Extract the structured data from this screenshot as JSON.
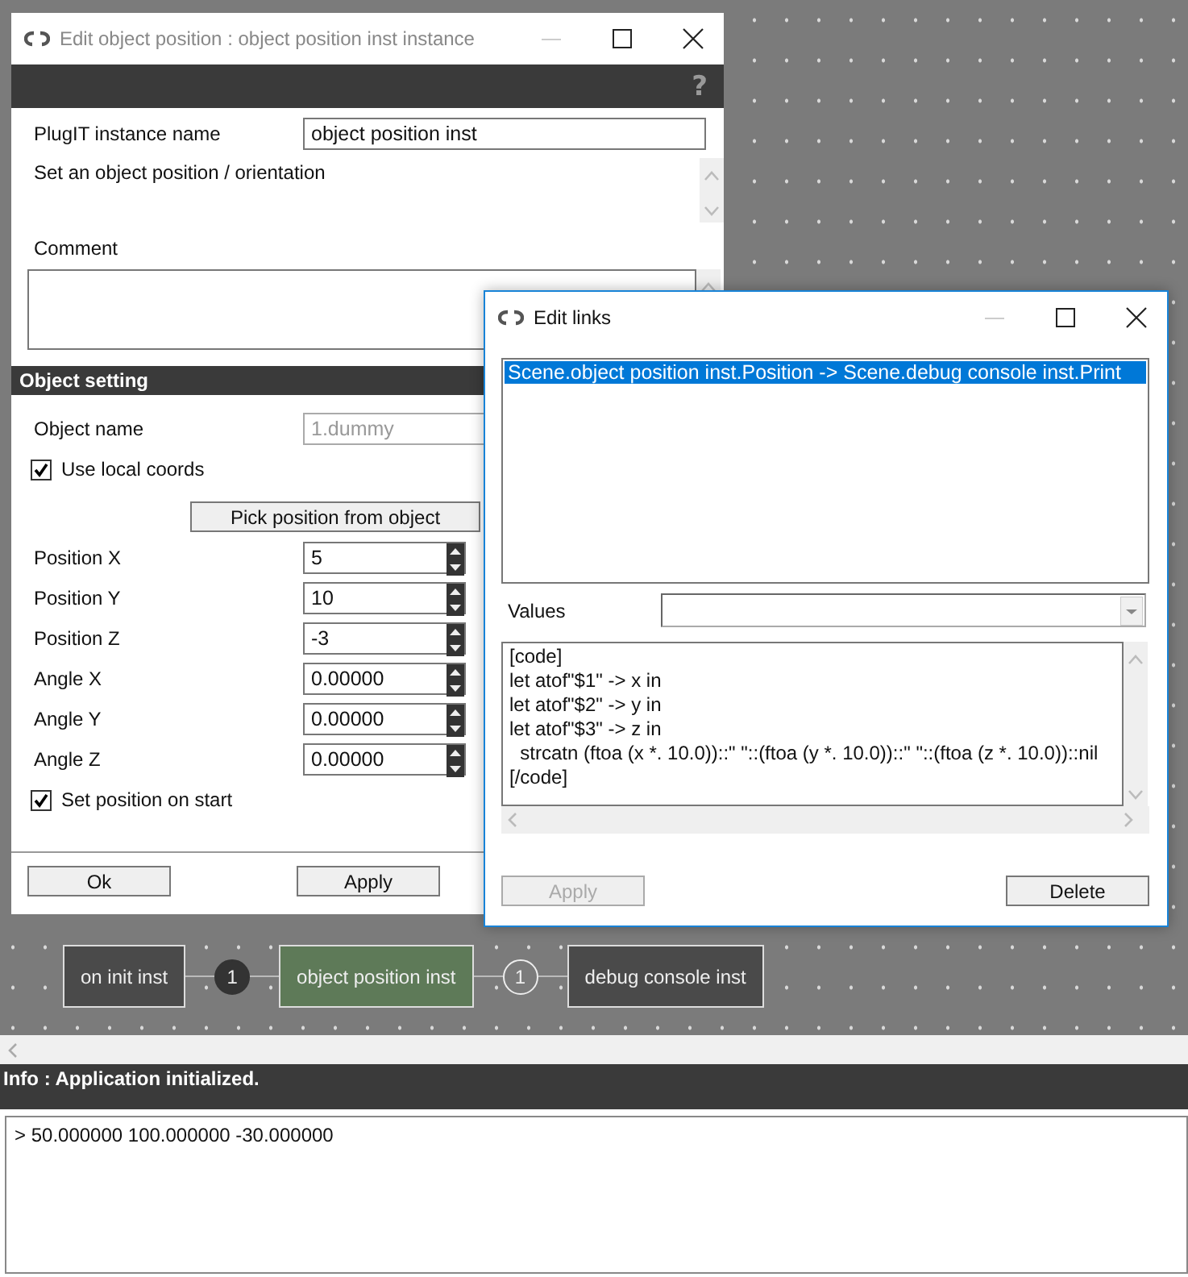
{
  "object_window": {
    "title": "Edit object position : object position inst instance",
    "help": "?",
    "instance_name": {
      "label": "PlugIT instance name",
      "value": "object position inst"
    },
    "description": "Set an object position / orientation",
    "comment": {
      "label": "Comment"
    },
    "section": "Object setting",
    "object_name": {
      "label": "Object name",
      "value": "1.dummy",
      "disabled": true
    },
    "use_local_coords": {
      "label": "Use local coords",
      "checked": true
    },
    "pick_button": "Pick position from object",
    "spinners": [
      {
        "label": "Position X",
        "value": "5"
      },
      {
        "label": "Position Y",
        "value": "10"
      },
      {
        "label": "Position Z",
        "value": "-3"
      },
      {
        "label": "Angle X",
        "value": "0.00000"
      },
      {
        "label": "Angle Y",
        "value": "0.00000"
      },
      {
        "label": "Angle Z",
        "value": "0.00000"
      }
    ],
    "set_on_start": {
      "label": "Set position on start",
      "checked": true
    },
    "buttons": [
      {
        "label": "Ok",
        "disabled": false
      },
      {
        "label": "Apply",
        "disabled": false
      }
    ]
  },
  "links_window": {
    "title": "Edit links",
    "links": [
      {
        "text": "Scene.object position inst.Position -> Scene.debug console inst.Print",
        "selected": true
      }
    ],
    "values_label": "Values",
    "code": [
      "[code]",
      "let atof\"$1\" -> x in",
      "let atof\"$2\" -> y in",
      "let atof\"$3\" -> z in",
      "  strcatn (ftoa (x *. 10.0))::\" \"::(ftoa (y *. 10.0))::\" \"::(ftoa (z *. 10.0))::nil",
      "[/code]"
    ],
    "buttons": [
      {
        "label": "Apply",
        "disabled": true
      },
      {
        "label": "Delete",
        "disabled": false
      }
    ]
  },
  "graph": {
    "items": [
      {
        "kind": "node",
        "label": "on init inst",
        "selected": false
      },
      {
        "kind": "link",
        "label": "1",
        "selected": false
      },
      {
        "kind": "node",
        "label": "object position inst",
        "selected": true
      },
      {
        "kind": "link",
        "label": "1",
        "selected": true
      },
      {
        "kind": "node",
        "label": "debug console inst",
        "selected": false
      }
    ]
  },
  "status": {
    "info": "Info : Application initialized.",
    "console": "> 50.000000 100.000000 -30.000000"
  }
}
